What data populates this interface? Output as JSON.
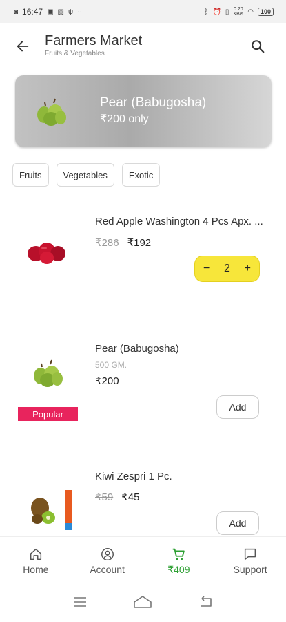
{
  "status_bar": {
    "time": "16:47",
    "left_icons": [
      "whatsapp-icon",
      "message-icon",
      "photo-icon",
      "usb-icon",
      "more-icon"
    ],
    "speed": "0.20\nKB/s",
    "battery": "100"
  },
  "header": {
    "title": "Farmers Market",
    "subtitle": "Fruits & Vegetables"
  },
  "banner": {
    "title": "Pear (Babugosha)",
    "subtitle": "₹200 only"
  },
  "chips": [
    "Fruits",
    "Vegetables",
    "Exotic"
  ],
  "products": [
    {
      "name": "Red Apple Washington 4 Pcs Apx. ...",
      "old_price": "₹286",
      "price": "₹192",
      "quantity": "2",
      "minus": "−",
      "plus": "+"
    },
    {
      "name": "Pear (Babugosha)",
      "weight": "500 GM.",
      "price": "₹200",
      "badge": "Popular",
      "action": "Add"
    },
    {
      "name": "Kiwi Zespri 1 Pc.",
      "old_price": "₹59",
      "price": "₹45",
      "action": "Add"
    }
  ],
  "bottom_nav": [
    {
      "label": "Home",
      "icon": "home-icon"
    },
    {
      "label": "Account",
      "icon": "account-icon"
    },
    {
      "label": "₹409",
      "icon": "cart-icon",
      "active": true
    },
    {
      "label": "Support",
      "icon": "chat-icon"
    }
  ],
  "colors": {
    "accent_green": "#2c9f32",
    "stepper_yellow": "#f7e63a",
    "badge_pink": "#e8245d"
  }
}
